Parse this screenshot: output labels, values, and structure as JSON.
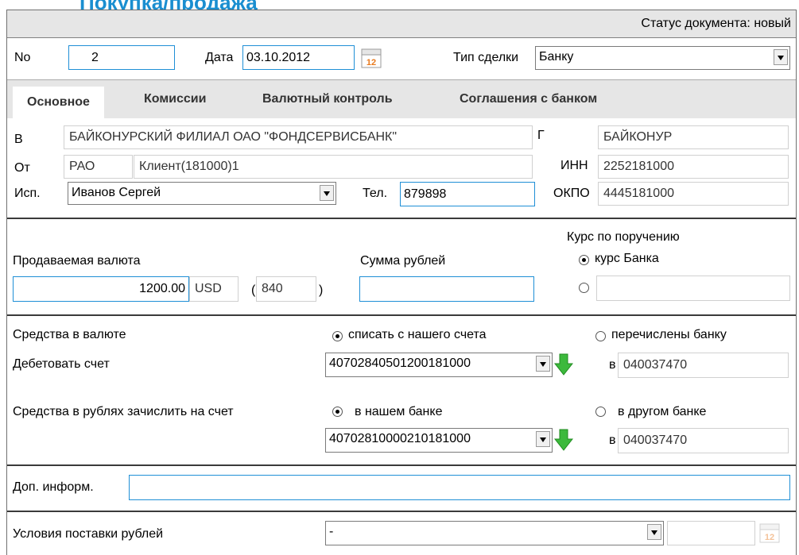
{
  "header": {
    "title_fragment": "Покупка/продажа"
  },
  "status": {
    "text": "Статус документа: новый"
  },
  "top": {
    "no_label": "No",
    "no_value": "2",
    "date_label": "Дата",
    "date_value": "03.10.2012",
    "deal_type_label": "Тип сделки",
    "deal_type_value": "Банку"
  },
  "tabs": [
    {
      "label": "Основное"
    },
    {
      "label": "Комиссии"
    },
    {
      "label": "Валютный контроль"
    },
    {
      "label": "Соглашения с банком"
    }
  ],
  "bank": {
    "to_label": "В",
    "to_value": "БАЙКОНУРСКИЙ ФИЛИАЛ ОАО \"ФОНДСЕРВИСБАНК\"",
    "city_label": "Г",
    "city_value": "БАЙКОНУР",
    "from_label": "От",
    "from_form": "РАО",
    "from_value": "Клиент(181000)1",
    "inn_label": "ИНН",
    "inn_value": "2252181000",
    "exec_label": "Исп.",
    "exec_value": "Иванов Сергей",
    "phone_label": "Тел.",
    "phone_value": "879898",
    "okpo_label": "ОКПО",
    "okpo_value": "4445181000"
  },
  "currency": {
    "rate_title": "Курс по поручению",
    "rate_bank_label": "курс Банка",
    "sold_label": "Продаваемая валюта",
    "amount_value": "1200.00",
    "currency_code": "USD",
    "code_open": "(",
    "code_value": "840",
    "code_close": ")",
    "rub_label": "Сумма рублей",
    "rub_value": "",
    "rate_custom_value": ""
  },
  "funds": {
    "fx_label": "Средства в валюте",
    "debit_label": "Дебетовать счет",
    "opt_own": "списать с нашего счета",
    "opt_bank": "перечислены банку",
    "debit_account": "40702840501200181000",
    "bik_prefix": "в",
    "debit_bik": "040037470",
    "rub_label": "Средства в рублях зачислить на счет",
    "opt_our_bank": "в нашем банке",
    "opt_other_bank": "в другом банке",
    "credit_account": "40702810000210181000",
    "credit_bik": "040037470"
  },
  "extra": {
    "label": "Доп. информ.",
    "value": ""
  },
  "delivery": {
    "label": "Условия поставки рублей",
    "value": "-",
    "date_value": ""
  },
  "icons": {
    "calendar": "calendar-icon",
    "arrow": "green-down-arrow-icon"
  },
  "colors": {
    "accent_border": "#1f8fd6",
    "title": "#1a8ed0",
    "arrow_green": "#3cb93c"
  }
}
